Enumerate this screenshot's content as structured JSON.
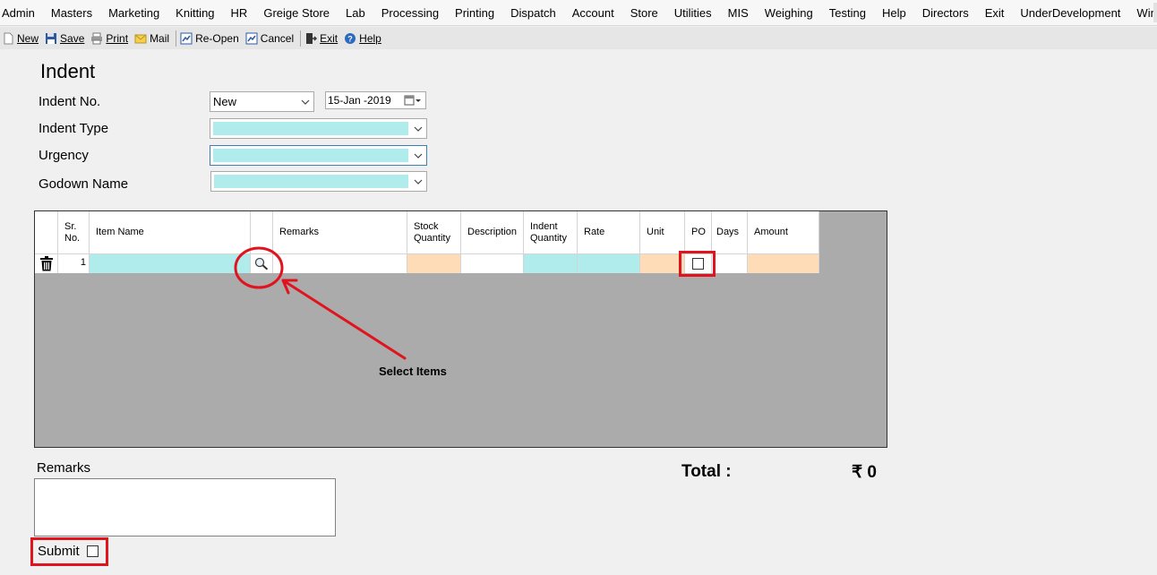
{
  "menu": [
    "Admin",
    "Masters",
    "Marketing",
    "Knitting",
    "HR",
    "Greige Store",
    "Lab",
    "Processing",
    "Printing",
    "Dispatch",
    "Account",
    "Store",
    "Utilities",
    "MIS",
    "Weighing",
    "Testing",
    "Help",
    "Directors",
    "Exit",
    "UnderDevelopment",
    "Windows"
  ],
  "toolbar": {
    "new": {
      "label": "New",
      "icon": "new-document-icon"
    },
    "save": {
      "label": "Save",
      "icon": "floppy-disk-icon"
    },
    "print": {
      "label": "Print",
      "icon": "printer-icon"
    },
    "mail": {
      "label": "Mail",
      "icon": "envelope-icon"
    },
    "reopen": {
      "label": "Re-Open",
      "icon": "reopen-icon"
    },
    "cancel": {
      "label": "Cancel",
      "icon": "cancel-icon"
    },
    "exit": {
      "label": "Exit",
      "icon": "exit-door-icon"
    },
    "help": {
      "label": "Help",
      "icon": "help-icon"
    }
  },
  "form": {
    "title": "Indent",
    "indent_no_label": "Indent No.",
    "indent_no_value": "New",
    "date_value": "15-Jan -2019",
    "indent_type_label": "Indent Type",
    "urgency_label": "Urgency",
    "godown_label": "Godown Name"
  },
  "grid": {
    "columns": {
      "sr_no": "Sr. No.",
      "item_name": "Item Name",
      "remarks": "Remarks",
      "stock_qty": "Stock Quantity",
      "description": "Description",
      "indent_qty": "Indent Quantity",
      "rate": "Rate",
      "unit": "Unit",
      "po": "PO",
      "days": "Days",
      "amount": "Amount"
    },
    "rows": [
      {
        "sr_no": "1",
        "item_name": "",
        "remarks": "",
        "stock_qty": "",
        "description": "",
        "indent_qty": "",
        "rate": "",
        "unit": "",
        "po": false,
        "days": "",
        "amount": ""
      }
    ]
  },
  "annotation": {
    "text": "Select Items"
  },
  "footer": {
    "remarks_label": "Remarks",
    "total_label": "Total :",
    "total_value": "₹ 0",
    "submit_label": "Submit"
  },
  "colors": {
    "highlight_red": "#e0141e",
    "input_cyan": "#b0ecec",
    "readonly_peach": "#ffdcb8",
    "grid_bg": "#ababab"
  }
}
